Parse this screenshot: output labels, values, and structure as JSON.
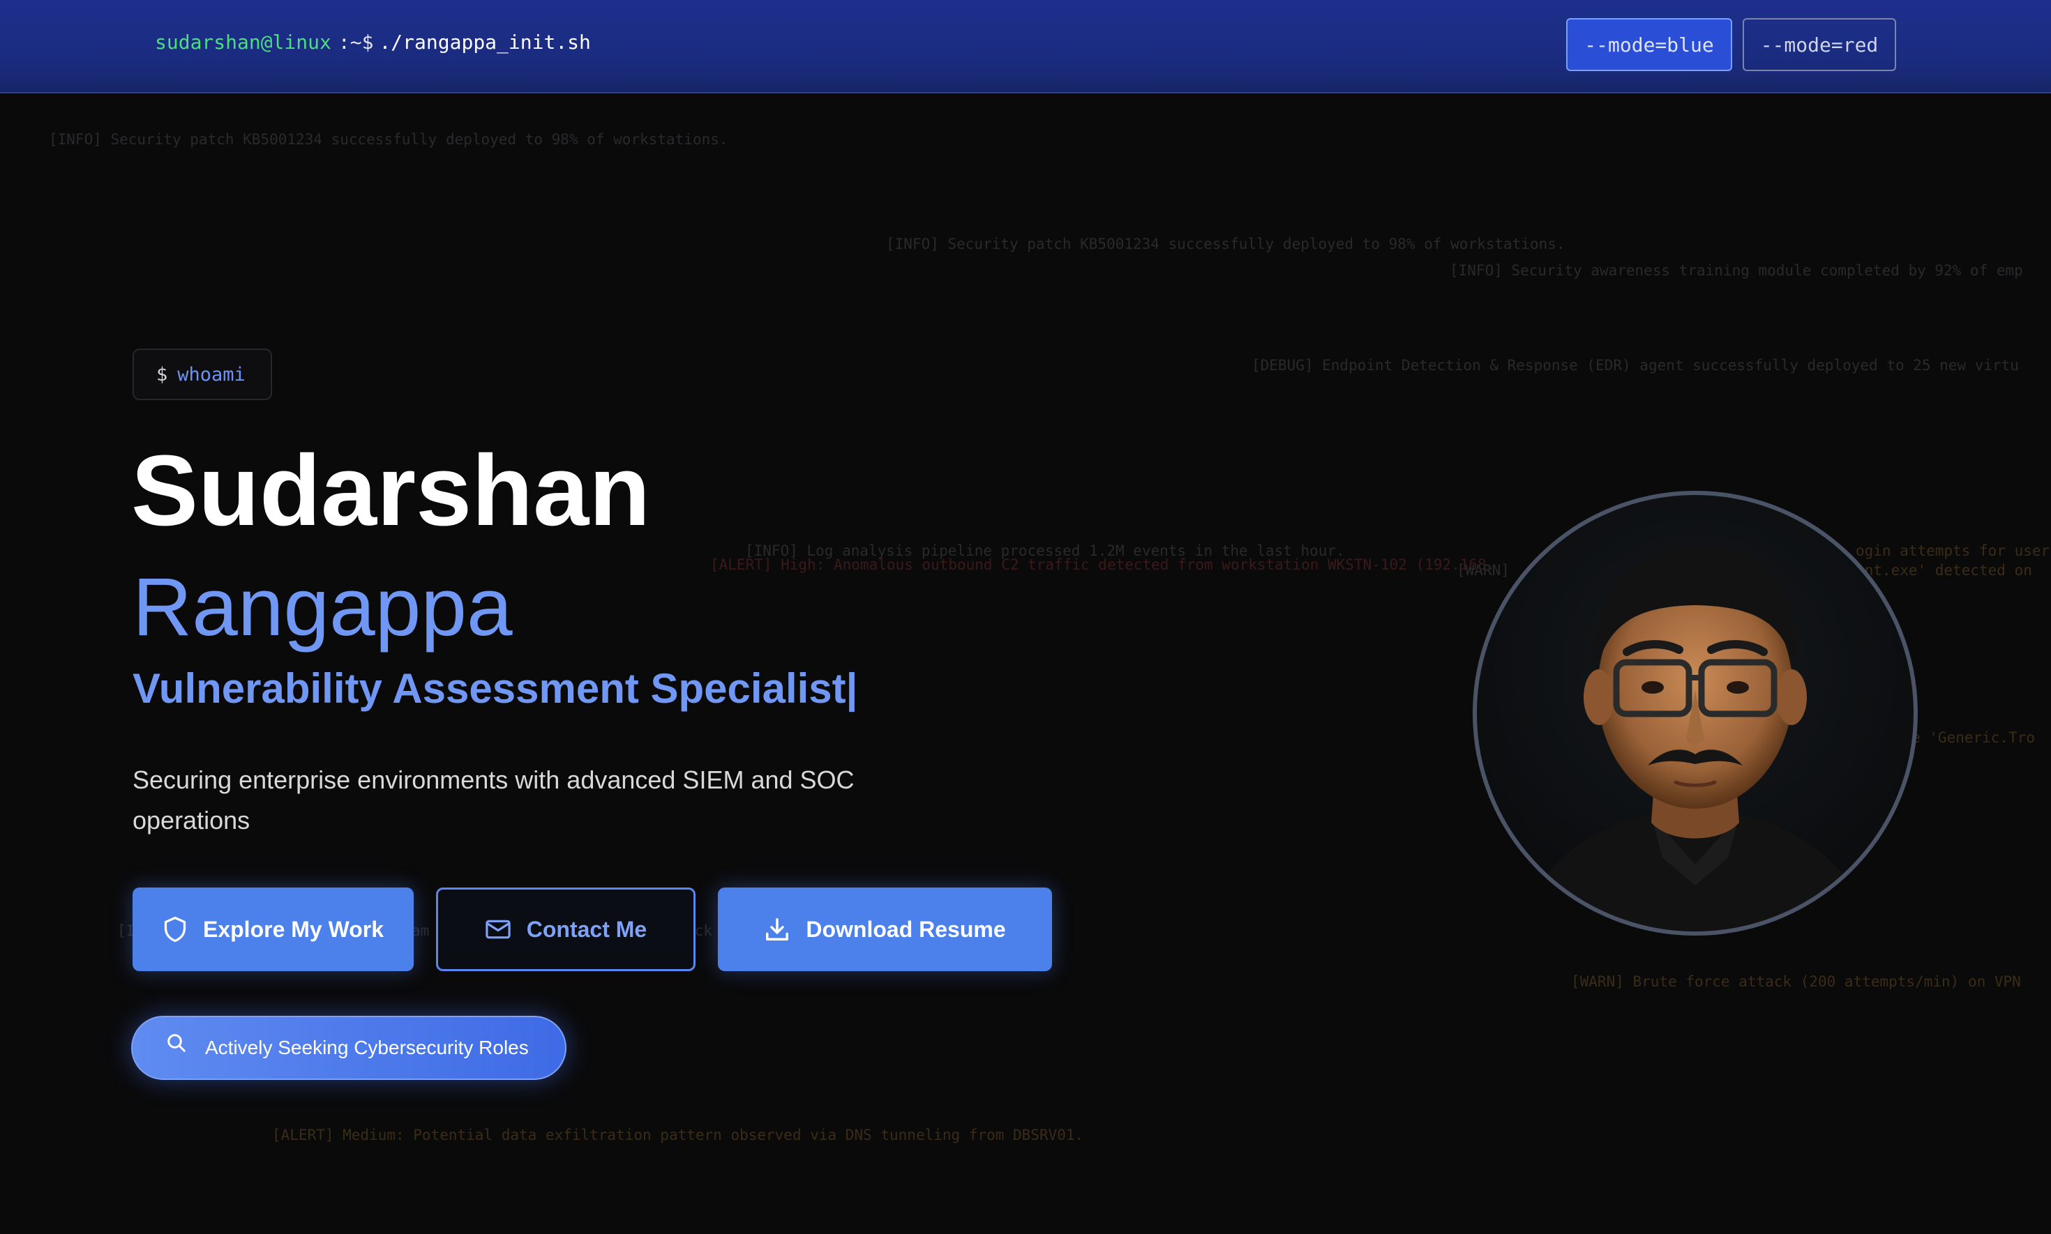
{
  "header": {
    "prompt_user": "sudarshan@linux",
    "prompt_path": ":~$",
    "prompt_command": "./rangappa_init.sh",
    "mode_blue_label": "--mode=blue",
    "mode_red_label": "--mode=red"
  },
  "background_logs": [
    "[INFO] Security patch KB5001234 successfully deployed to 98% of workstations.",
    "[INFO] Security patch KB5001234 successfully deployed to 98% of workstations.",
    "[INFO] Security awareness training module completed by 92% of emp",
    "[DEBUG] Endpoint Detection & Response (EDR) agent successfully deployed to 25 new virtu",
    "[INFO] Log analysis pipeline processed 1.2M events in the last hour.",
    "[ALERT] High: Anomalous outbound C2 traffic detected from workstation WKSTN-102 (192.168.",
    "[WARN]",
    "ogin attempts for user",
    "ent.exe' detected on",
    "e 'Generic.Tro",
    "[I",
    "am (IPS)",
    "attack",
    "[WARN] Brute force attack (200 attempts/min) on VPN",
    "[ALERT] Medium: Potential data exfiltration pattern observed via DNS tunneling from DBSRV01."
  ],
  "hero": {
    "whoami_prompt": "$",
    "whoami_cmd": "whoami",
    "first_name": "Sudarshan",
    "last_name": "Rangappa",
    "role": "Vulnerability Assessment Specialist|",
    "tagline": "Securing enterprise environments with advanced SIEM and SOC operations"
  },
  "actions": {
    "explore_label": "Explore My Work",
    "contact_label": "Contact Me",
    "resume_label": "Download Resume",
    "seeking_label": "Actively Seeking Cybersecurity Roles"
  },
  "icons": {
    "explore": "shield-icon",
    "contact": "mail-icon",
    "resume": "download-icon",
    "seeking": "search-icon"
  },
  "colors": {
    "accent": "#4c80ea",
    "header_bg": "#1d2f8c",
    "prompt_user": "#4ade80"
  }
}
